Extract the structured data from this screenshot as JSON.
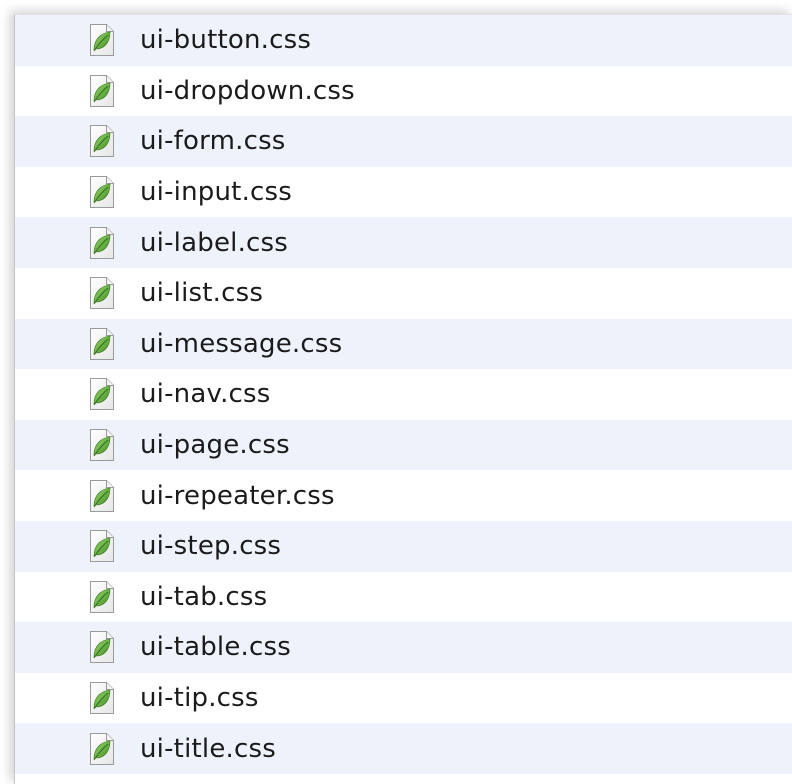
{
  "files": [
    {
      "name": "ui-button.css",
      "icon": "css-leaf-file-icon"
    },
    {
      "name": "ui-dropdown.css",
      "icon": "css-leaf-file-icon"
    },
    {
      "name": "ui-form.css",
      "icon": "css-leaf-file-icon"
    },
    {
      "name": "ui-input.css",
      "icon": "css-leaf-file-icon"
    },
    {
      "name": "ui-label.css",
      "icon": "css-leaf-file-icon"
    },
    {
      "name": "ui-list.css",
      "icon": "css-leaf-file-icon"
    },
    {
      "name": "ui-message.css",
      "icon": "css-leaf-file-icon"
    },
    {
      "name": "ui-nav.css",
      "icon": "css-leaf-file-icon"
    },
    {
      "name": "ui-page.css",
      "icon": "css-leaf-file-icon"
    },
    {
      "name": "ui-repeater.css",
      "icon": "css-leaf-file-icon"
    },
    {
      "name": "ui-step.css",
      "icon": "css-leaf-file-icon"
    },
    {
      "name": "ui-tab.css",
      "icon": "css-leaf-file-icon"
    },
    {
      "name": "ui-table.css",
      "icon": "css-leaf-file-icon"
    },
    {
      "name": "ui-tip.css",
      "icon": "css-leaf-file-icon"
    },
    {
      "name": "ui-title.css",
      "icon": "css-leaf-file-icon"
    }
  ],
  "colors": {
    "stripe": "#edf2fb",
    "leaf": "#5cad3a",
    "text": "#1b1b1b"
  }
}
